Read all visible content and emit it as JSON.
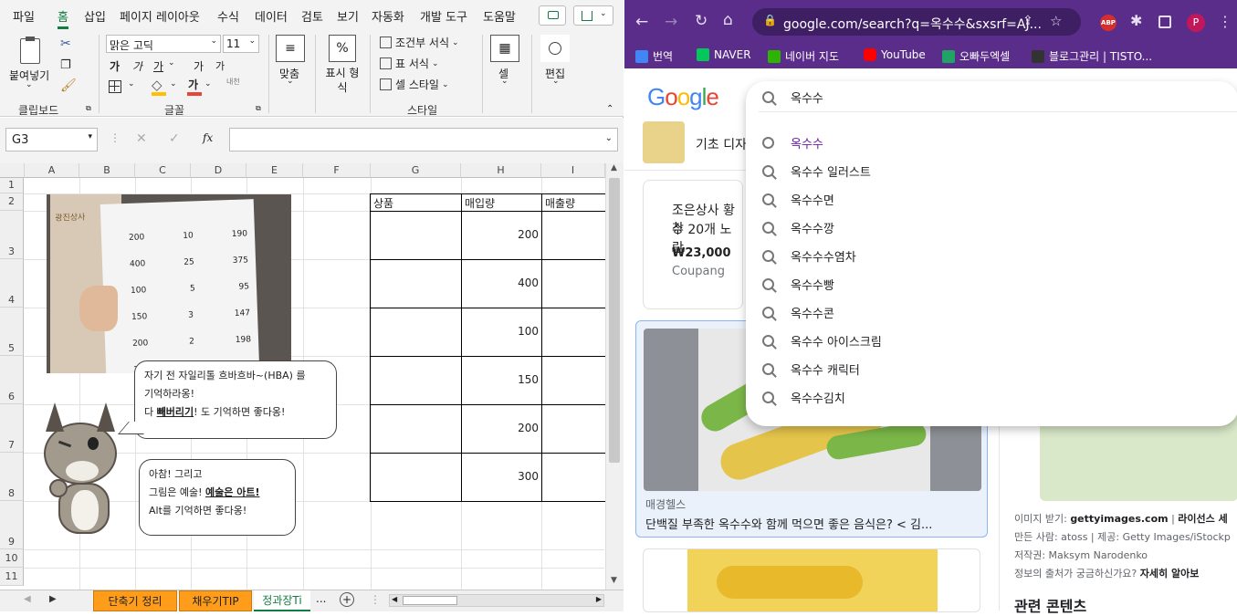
{
  "excel": {
    "menu_tabs": [
      "파일",
      "홈",
      "삽입",
      "페이지 레이아웃",
      "수식",
      "데이터",
      "검토",
      "보기",
      "자동화",
      "개발 도구",
      "도움말"
    ],
    "clipboard": {
      "paste_label": "붙여넣기",
      "group": "클립보드"
    },
    "font": {
      "name": "맑은 고딕",
      "size": "11",
      "bold": "가",
      "italic": "가",
      "underline": "가",
      "grow": "가",
      "shrink": "가",
      "fill_letter": "가",
      "phonetic": "내천",
      "group": "글꼴"
    },
    "align": {
      "label": "맞춤"
    },
    "number": {
      "label": "표시 형식",
      "icon": "%"
    },
    "styles": {
      "conditional": "조건부 서식",
      "table": "표 서식",
      "cell": "셀 스타일",
      "group": "스타일"
    },
    "cells": {
      "label": "셀"
    },
    "editing": {
      "label": "편집"
    },
    "namebox": "G3",
    "formula_fx": "fx",
    "columns": [
      "A",
      "B",
      "C",
      "D",
      "E",
      "F",
      "G",
      "H",
      "I"
    ],
    "rows": [
      "1",
      "2",
      "3",
      "4",
      "5",
      "6",
      "7",
      "8",
      "9",
      "10",
      "11"
    ],
    "table": {
      "headers": [
        "상품",
        "매입량",
        "매출량"
      ],
      "values": [
        "200",
        "400",
        "100",
        "150",
        "200",
        "300"
      ]
    },
    "bubble1": {
      "line1": "자기 전 자일리톨 흐바흐바~(HBA) 를",
      "line2": "기억하라옹!",
      "line3a": "다 ",
      "line3b": "빼버리기",
      "line3c": "! 도 기억하면 좋다옹!"
    },
    "bubble2": {
      "line1": "아참! 그리고",
      "line2a": "그림은 예술! ",
      "line2b": "예술은 아트!",
      "line3": "Alt를 기억하면 좋다옹!"
    },
    "photo_sign": "광진상사",
    "photo_rows": [
      [
        "200",
        "10",
        "190"
      ],
      [
        "400",
        "25",
        "375"
      ],
      [
        "100",
        "5",
        "95"
      ],
      [
        "150",
        "3",
        "147"
      ],
      [
        "200",
        "2",
        "198"
      ],
      [
        "300",
        "20",
        "280"
      ]
    ],
    "sheet_tabs": [
      "단축기 정리",
      "채우기TIP",
      "정과장Ti"
    ],
    "more": "...",
    "add_sheet": "+"
  },
  "chrome": {
    "url": "google.com/search?q=옥수수&sxsrf=AJ...",
    "ext_abp": "ABP",
    "profile": "P",
    "bookmarks": [
      "번역",
      "NAVER",
      "네이버 지도",
      "YouTube",
      "오빠두엑셀",
      "블로그관리 | TISTO..."
    ],
    "search_value": "옥수수",
    "history_suggestion": "옥수수",
    "suggestions": [
      "옥수수 일러스트",
      "옥수수면",
      "옥수수깡",
      "옥수수수염차",
      "옥수수빵",
      "옥수수콘",
      "옥수수 아이스크림",
      "옥수수 캐릭터",
      "옥수수김치"
    ],
    "chip_text": "기초 디자",
    "product": {
      "title1": "조은상사 황창",
      "title2": "수 20개 노란",
      "price": "₩23,000",
      "store": "Coupang"
    },
    "result1": {
      "source": "매경헬스",
      "title": "단백질 부족한 옥수수와 함께 먹으면 좋은 음식은? < 김..."
    },
    "info": {
      "l1a": "이미지 받기: ",
      "l1b": "gettyimages.com",
      "l1c": " | ",
      "l1d": "라이선스 세",
      "l2": "만든 사람: atoss | 제공: Getty Images/iStockp",
      "l3": "저작권: Maksym Narodenko",
      "l4a": "정보의 출처가 궁금하신가요? ",
      "l4b": "자세히 알아보",
      "related": "관련 콘텐츠"
    },
    "colors": {
      "google_blue": "#4285F4",
      "google_red": "#EA4335",
      "google_yellow": "#FBBC05",
      "google_green": "#34A853",
      "chrome_purple": "#5b2d8a"
    }
  }
}
